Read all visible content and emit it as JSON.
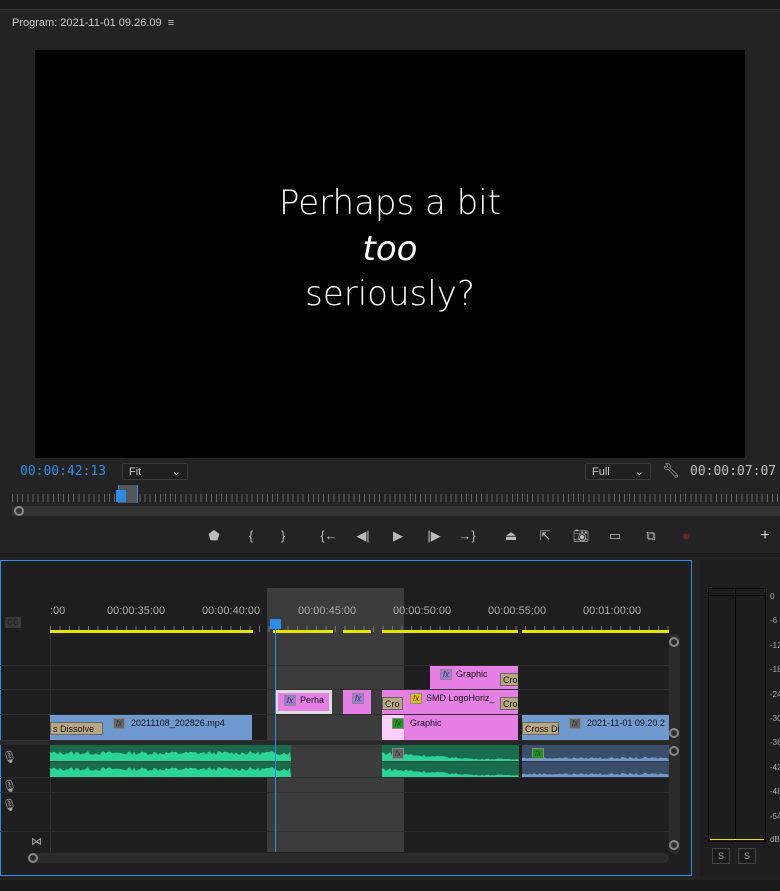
{
  "program": {
    "title": "Program: 2021-11-01 09.26.09",
    "menu_icon": "hamburger-icon",
    "frame_text": [
      "Perhaps a bit",
      "too",
      "seriously?"
    ],
    "current_timecode": "00:00:42:13",
    "zoom": "Fit",
    "resolution": "Full",
    "duration_timecode": "00:00:07:07",
    "accent": "#2d8ceb",
    "controls": [
      "marker-icon",
      "mark-in-icon",
      "mark-out-icon",
      "go-to-in-icon",
      "step-back-icon",
      "play-icon",
      "step-forward-icon",
      "go-to-out-icon",
      "lift-icon",
      "extract-icon",
      "export-frame-icon",
      "comparison-view-icon",
      "multicam-icon",
      "record-icon",
      "add-button-icon"
    ]
  },
  "timeline": {
    "cc_label": "CC",
    "ruler": [
      ":00",
      "00:00:35:00",
      "00:00:40:00",
      "00:00:45:00",
      "00:00:50:00",
      "00:00:55:00",
      "00:01:00:00"
    ],
    "clips": {
      "v4_graphic": "Graphic",
      "v3_perha": "Perha",
      "v3_smd": "SMD LogoHoriz_",
      "v1_mp4": "20211108_202826.mp4",
      "v1_graphic": "Graphic",
      "v1_last": "2021-11-01 09.20.2"
    },
    "transitions": {
      "dissolve": "s Dissolve",
      "cross_di": "Cross Di",
      "cro": "Cro"
    },
    "fx": "fx"
  },
  "meter": {
    "scale": [
      "0",
      "-6",
      "-12",
      "-18",
      "-24",
      "-30",
      "-36",
      "-42",
      "-48",
      "-54",
      "dB"
    ],
    "solo": [
      "S",
      "S"
    ]
  }
}
